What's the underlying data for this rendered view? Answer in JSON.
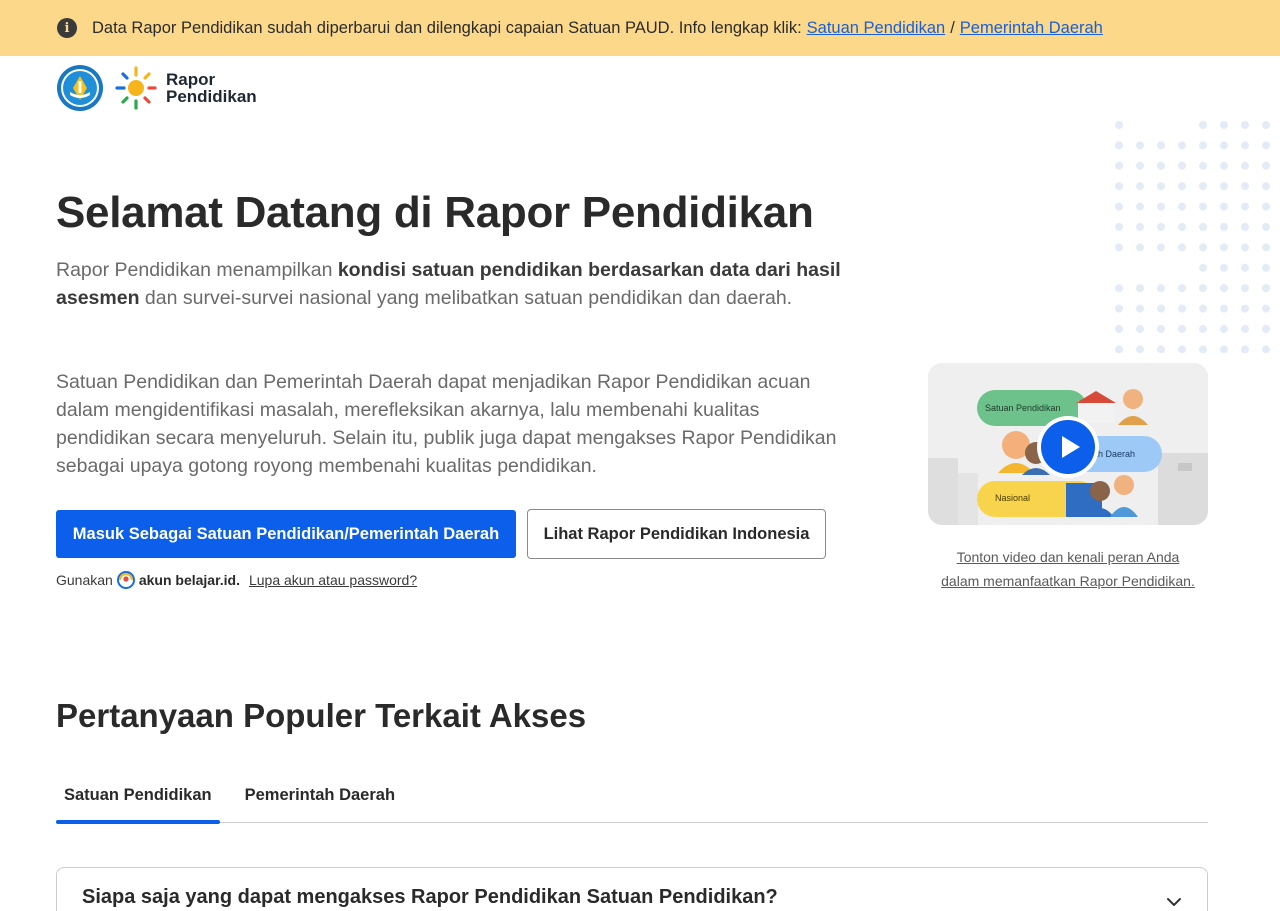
{
  "banner": {
    "icon": "info-icon",
    "text": "Data Rapor Pendidikan sudah diperbarui dan dilengkapi capaian Satuan PAUD. Info lengkap klik:",
    "link1": "Satuan Pendidikan",
    "separator": "/",
    "link2": "Pemerintah Daerah",
    "bg_color": "#fcd98a"
  },
  "header": {
    "logo_line1": "Rapor",
    "logo_line2": "Pendidikan"
  },
  "hero": {
    "title": "Selamat Datang di Rapor Pendidikan",
    "p1_start": "Rapor Pendidikan menampilkan ",
    "p1_bold": "kondisi satuan pendidikan berdasarkan data dari hasil asesmen",
    "p1_end": " dan survei-survei nasional yang melibatkan satuan pendidikan dan daerah.",
    "p2": "Satuan Pendidikan dan Pemerintah Daerah dapat menjadikan Rapor Pendidikan acuan dalam mengidentifikasi masalah, merefleksikan akarnya, lalu membenahi kualitas pendidikan secara menyeluruh. Selain itu, publik juga dapat mengakses Rapor Pendidikan sebagai upaya gotong royong membenahi kualitas pendidikan.",
    "primary_button": "Masuk Sebagai Satuan Pendidikan/Pemerintah Daerah",
    "secondary_button": "Lihat Rapor Pendidikan Indonesia",
    "account_prefix": "Gunakan",
    "account_name": "akun belajar.id.",
    "forgot_link": "Lupa akun atau password?",
    "accent_color": "#0b5fea"
  },
  "video": {
    "label1": "Satuan Pendidikan",
    "label2": "Pemerintah Daerah",
    "label3": "Nasional",
    "caption_line1": "Tonton video dan kenali peran Anda",
    "caption_line2": "dalam memanfaatkan Rapor Pendidikan."
  },
  "faq": {
    "title": "Pertanyaan Populer Terkait Akses",
    "tabs": [
      "Satuan Pendidikan",
      "Pemerintah Daerah"
    ],
    "active_tab": "Satuan Pendidikan",
    "question1": "Siapa saja yang dapat mengakses Rapor Pendidikan Satuan Pendidikan?"
  }
}
